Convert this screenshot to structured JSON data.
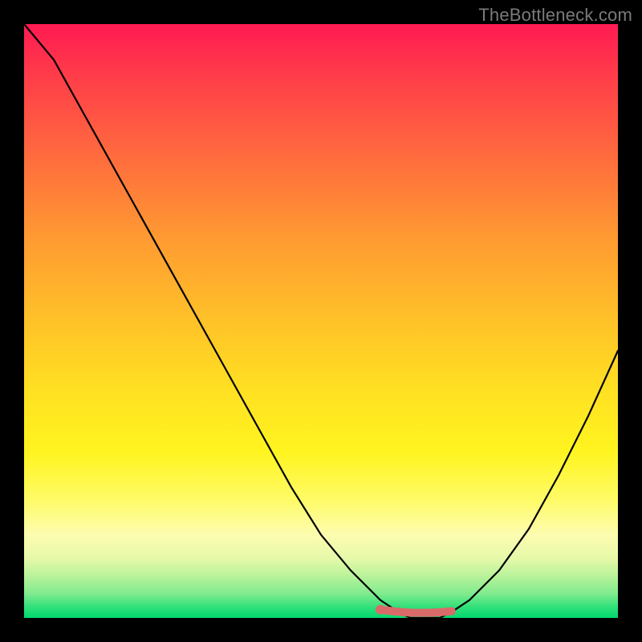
{
  "attribution": "TheBottleneck.com",
  "chart_data": {
    "type": "line",
    "title": "",
    "xlabel": "",
    "ylabel": "",
    "xlim": [
      0,
      100
    ],
    "ylim": [
      0,
      100
    ],
    "x": [
      0,
      5,
      10,
      15,
      20,
      25,
      30,
      35,
      40,
      45,
      50,
      55,
      60,
      63,
      65,
      68,
      70,
      72,
      75,
      80,
      85,
      90,
      95,
      100
    ],
    "values": [
      100,
      94,
      85,
      76,
      67,
      58,
      49,
      40,
      31,
      22,
      14,
      8,
      3,
      1,
      0,
      0,
      0,
      1,
      3,
      8,
      15,
      24,
      34,
      45
    ],
    "highlight": {
      "x_range": [
        60,
        72
      ],
      "y": 1,
      "color": "#d96a6a"
    },
    "colors": {
      "curve": "#000000",
      "highlight": "#d96a6a",
      "background_top": "#ff1a52",
      "background_bottom": "#00d96f"
    }
  }
}
